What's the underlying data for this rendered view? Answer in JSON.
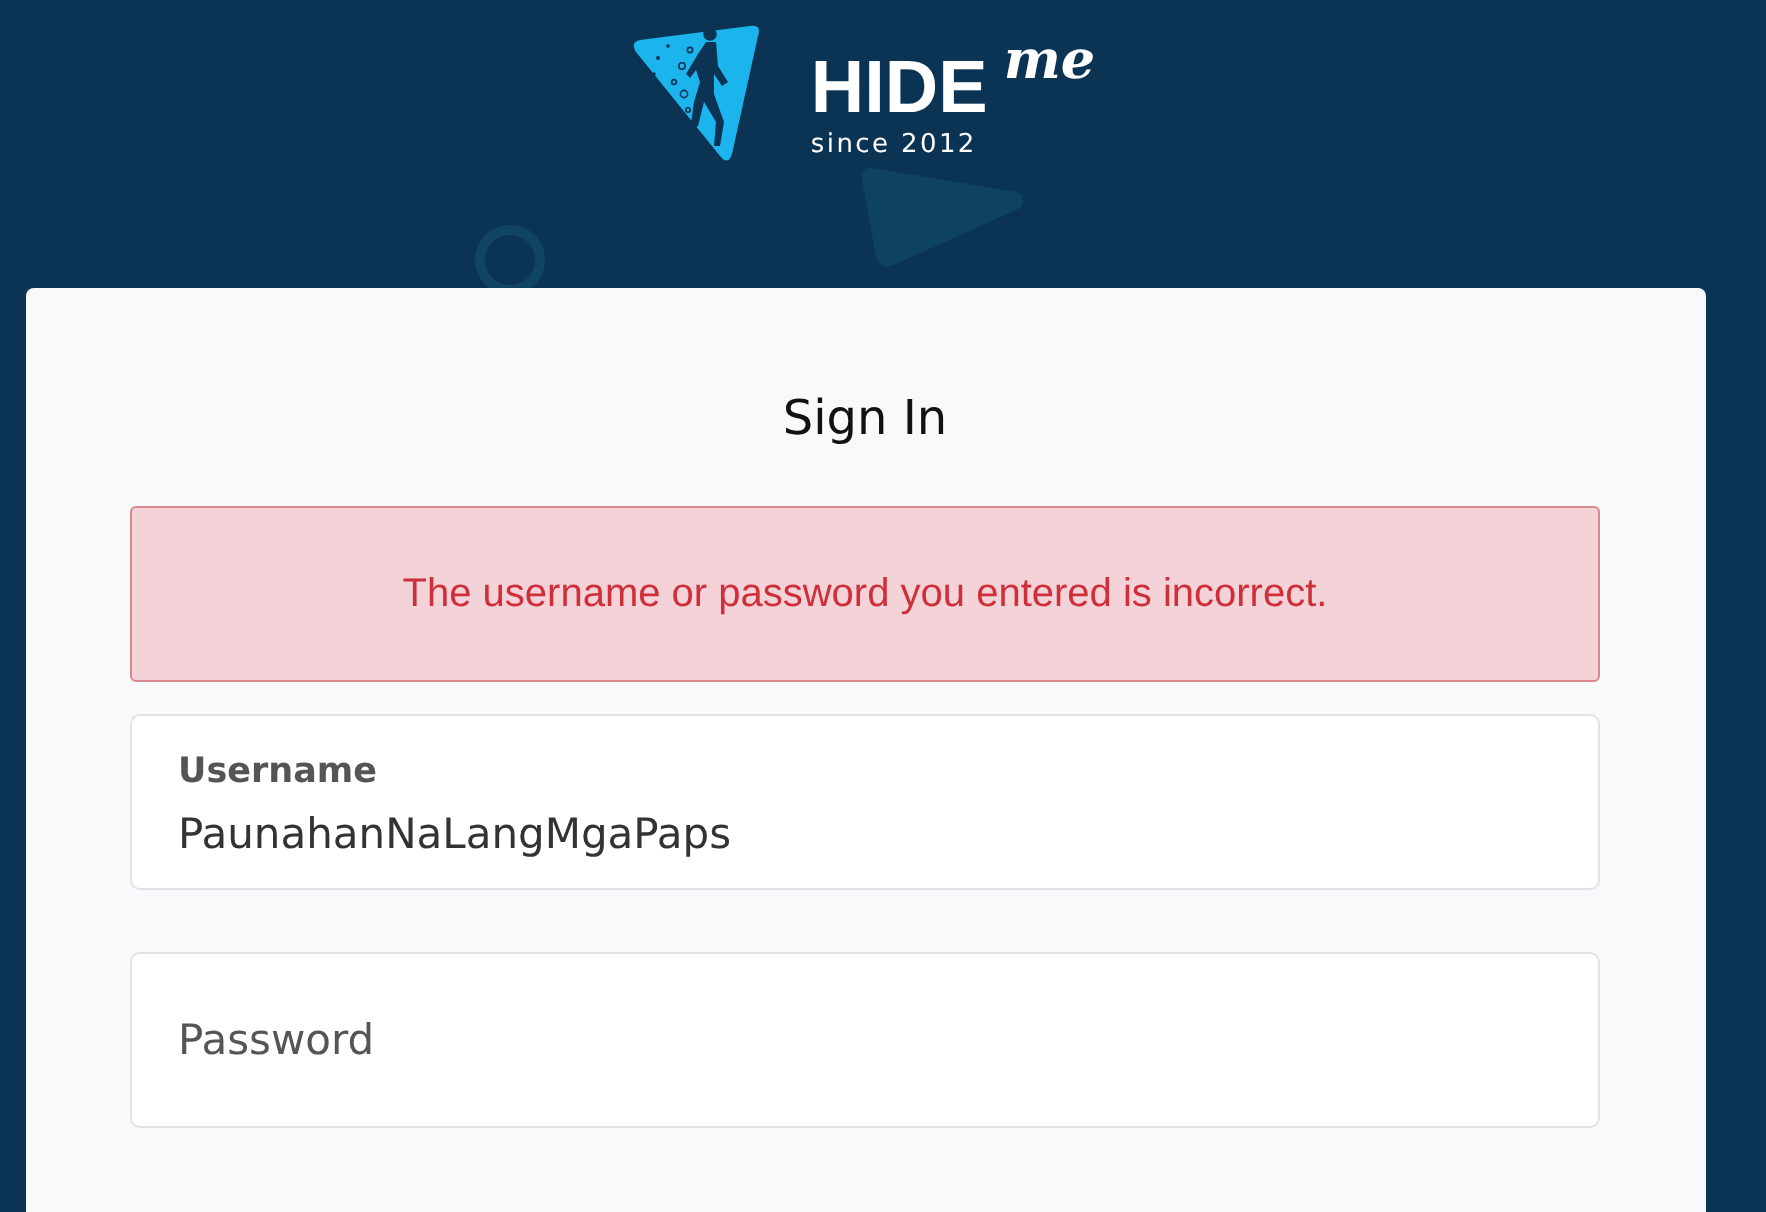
{
  "logo": {
    "wordmark": "HIDE",
    "script": "me",
    "tagline": "since 2012"
  },
  "form": {
    "title": "Sign In",
    "alert": {
      "kind": "error",
      "message": "The username or password you entered is incorrect."
    },
    "fields": [
      {
        "label": "Username",
        "value": "PaunahanNaLangMgaPaps"
      },
      {
        "placeholder": "Password"
      }
    ]
  }
}
